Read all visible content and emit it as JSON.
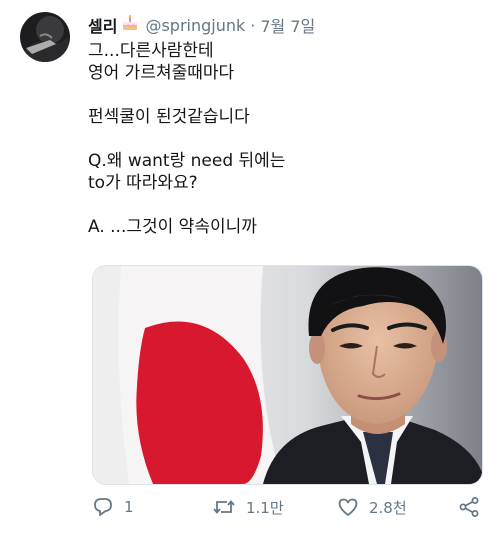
{
  "tweet": {
    "author_name": "셀리",
    "handle": "@springjunk",
    "separator": "·",
    "date": "7월 7일",
    "lines": [
      "그...다른사람한테",
      "영어 가르쳐줄때마다",
      "",
      "펀섹쿨이 된것같습니다",
      "",
      "Q.왜 want랑 need 뒤에는",
      "to가 따라와요?",
      "",
      "A. ...그것이 약속이니까"
    ]
  },
  "actions": {
    "reply_count": "1",
    "retweet_count": "1.1만",
    "like_count": "2.8천"
  },
  "colors": {
    "text": "#14171a",
    "secondary": "#657786",
    "flag_red": "#d8182e"
  },
  "icons": [
    "cake-emoji-icon",
    "reply-icon",
    "retweet-icon",
    "like-icon",
    "share-icon"
  ]
}
